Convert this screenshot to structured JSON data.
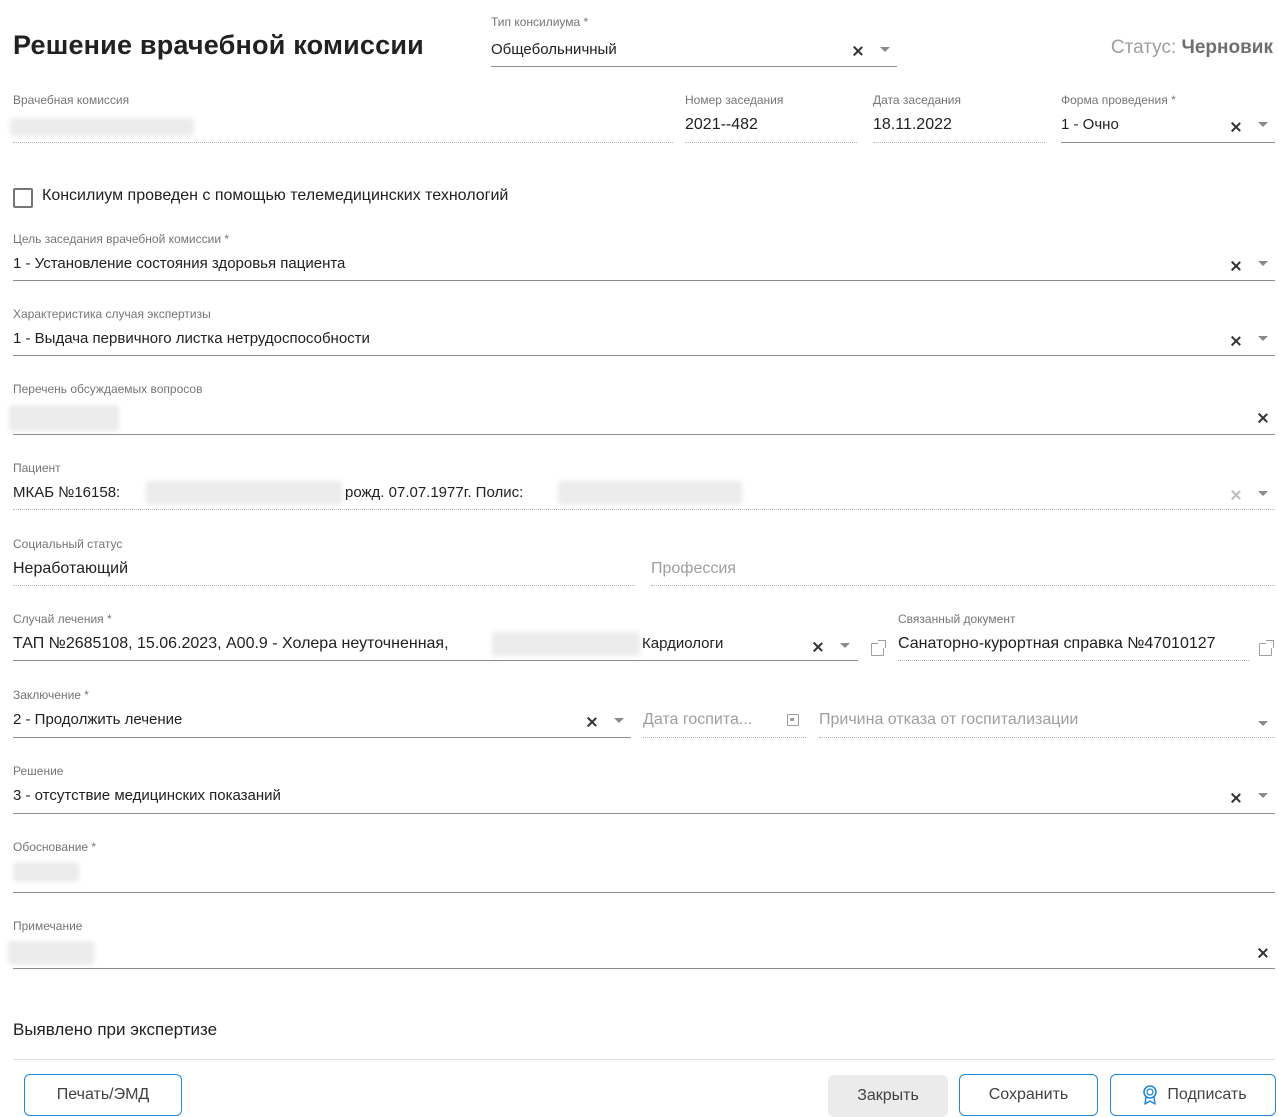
{
  "header": {
    "title": "Решение врачебной комиссии",
    "status_label": "Статус:",
    "status_value": "Черновик"
  },
  "consilium_type": {
    "label": "Тип консилиума *",
    "value": "Общебольничный"
  },
  "commission": {
    "label": "Врачебная комиссия",
    "session_number_label": "Номер заседания",
    "session_number": "2021--482",
    "session_date_label": "Дата заседания",
    "session_date": "18.11.2022",
    "form_label": "Форма проведения *",
    "form_value": "1 - Очно"
  },
  "telemedicine": {
    "label": "Консилиум проведен с помощью телемедицинских технологий",
    "checked": false
  },
  "purpose": {
    "label": "Цель заседания врачебной комиссии *",
    "value": "1 - Установление состояния здоровья пациента"
  },
  "expertise": {
    "label": "Характеристика случая экспертизы",
    "value": "1 - Выдача первичного листка нетрудоспособности"
  },
  "questions": {
    "label": "Перечень обсуждаемых вопросов"
  },
  "patient": {
    "label": "Пациент",
    "prefix": "МКАБ №16158:",
    "birth": "рожд. 07.07.1977г. Полис:"
  },
  "social": {
    "label": "Социальный статус",
    "value": "Неработающий",
    "profession_placeholder": "Профессия"
  },
  "case": {
    "label": "Случай лечения *",
    "value": "ТАП №2685108, 15.06.2023, A00.9 - Холера неуточненная,",
    "suffix": "Кардиологи",
    "linked_label": "Связанный документ",
    "linked_value": "Санаторно-курортная справка №47010127"
  },
  "conclusion": {
    "label": "Заключение *",
    "value": "2 - Продолжить лечение",
    "hosp_date_placeholder": "Дата госпита...",
    "refusal_placeholder": "Причина отказа от госпитализации"
  },
  "decision": {
    "label": "Решение",
    "value": "3 - отсутствие медицинских показаний"
  },
  "justification": {
    "label": "Обоснование *"
  },
  "note": {
    "label": "Примечание"
  },
  "section": {
    "found_title": "Выявлено при экспертизе"
  },
  "footer": {
    "print_label": "Печать/ЭМД",
    "close_label": "Закрыть",
    "save_label": "Сохранить",
    "sign_label": "Подписать"
  },
  "colors": {
    "accent": "#1e88e5",
    "label": "#757575",
    "text": "#212121"
  },
  "icons": {
    "clear": "close-icon",
    "dropdown": "chevron-down-icon",
    "open": "external-link-icon",
    "calendar": "calendar-icon",
    "sign": "certificate-icon"
  }
}
